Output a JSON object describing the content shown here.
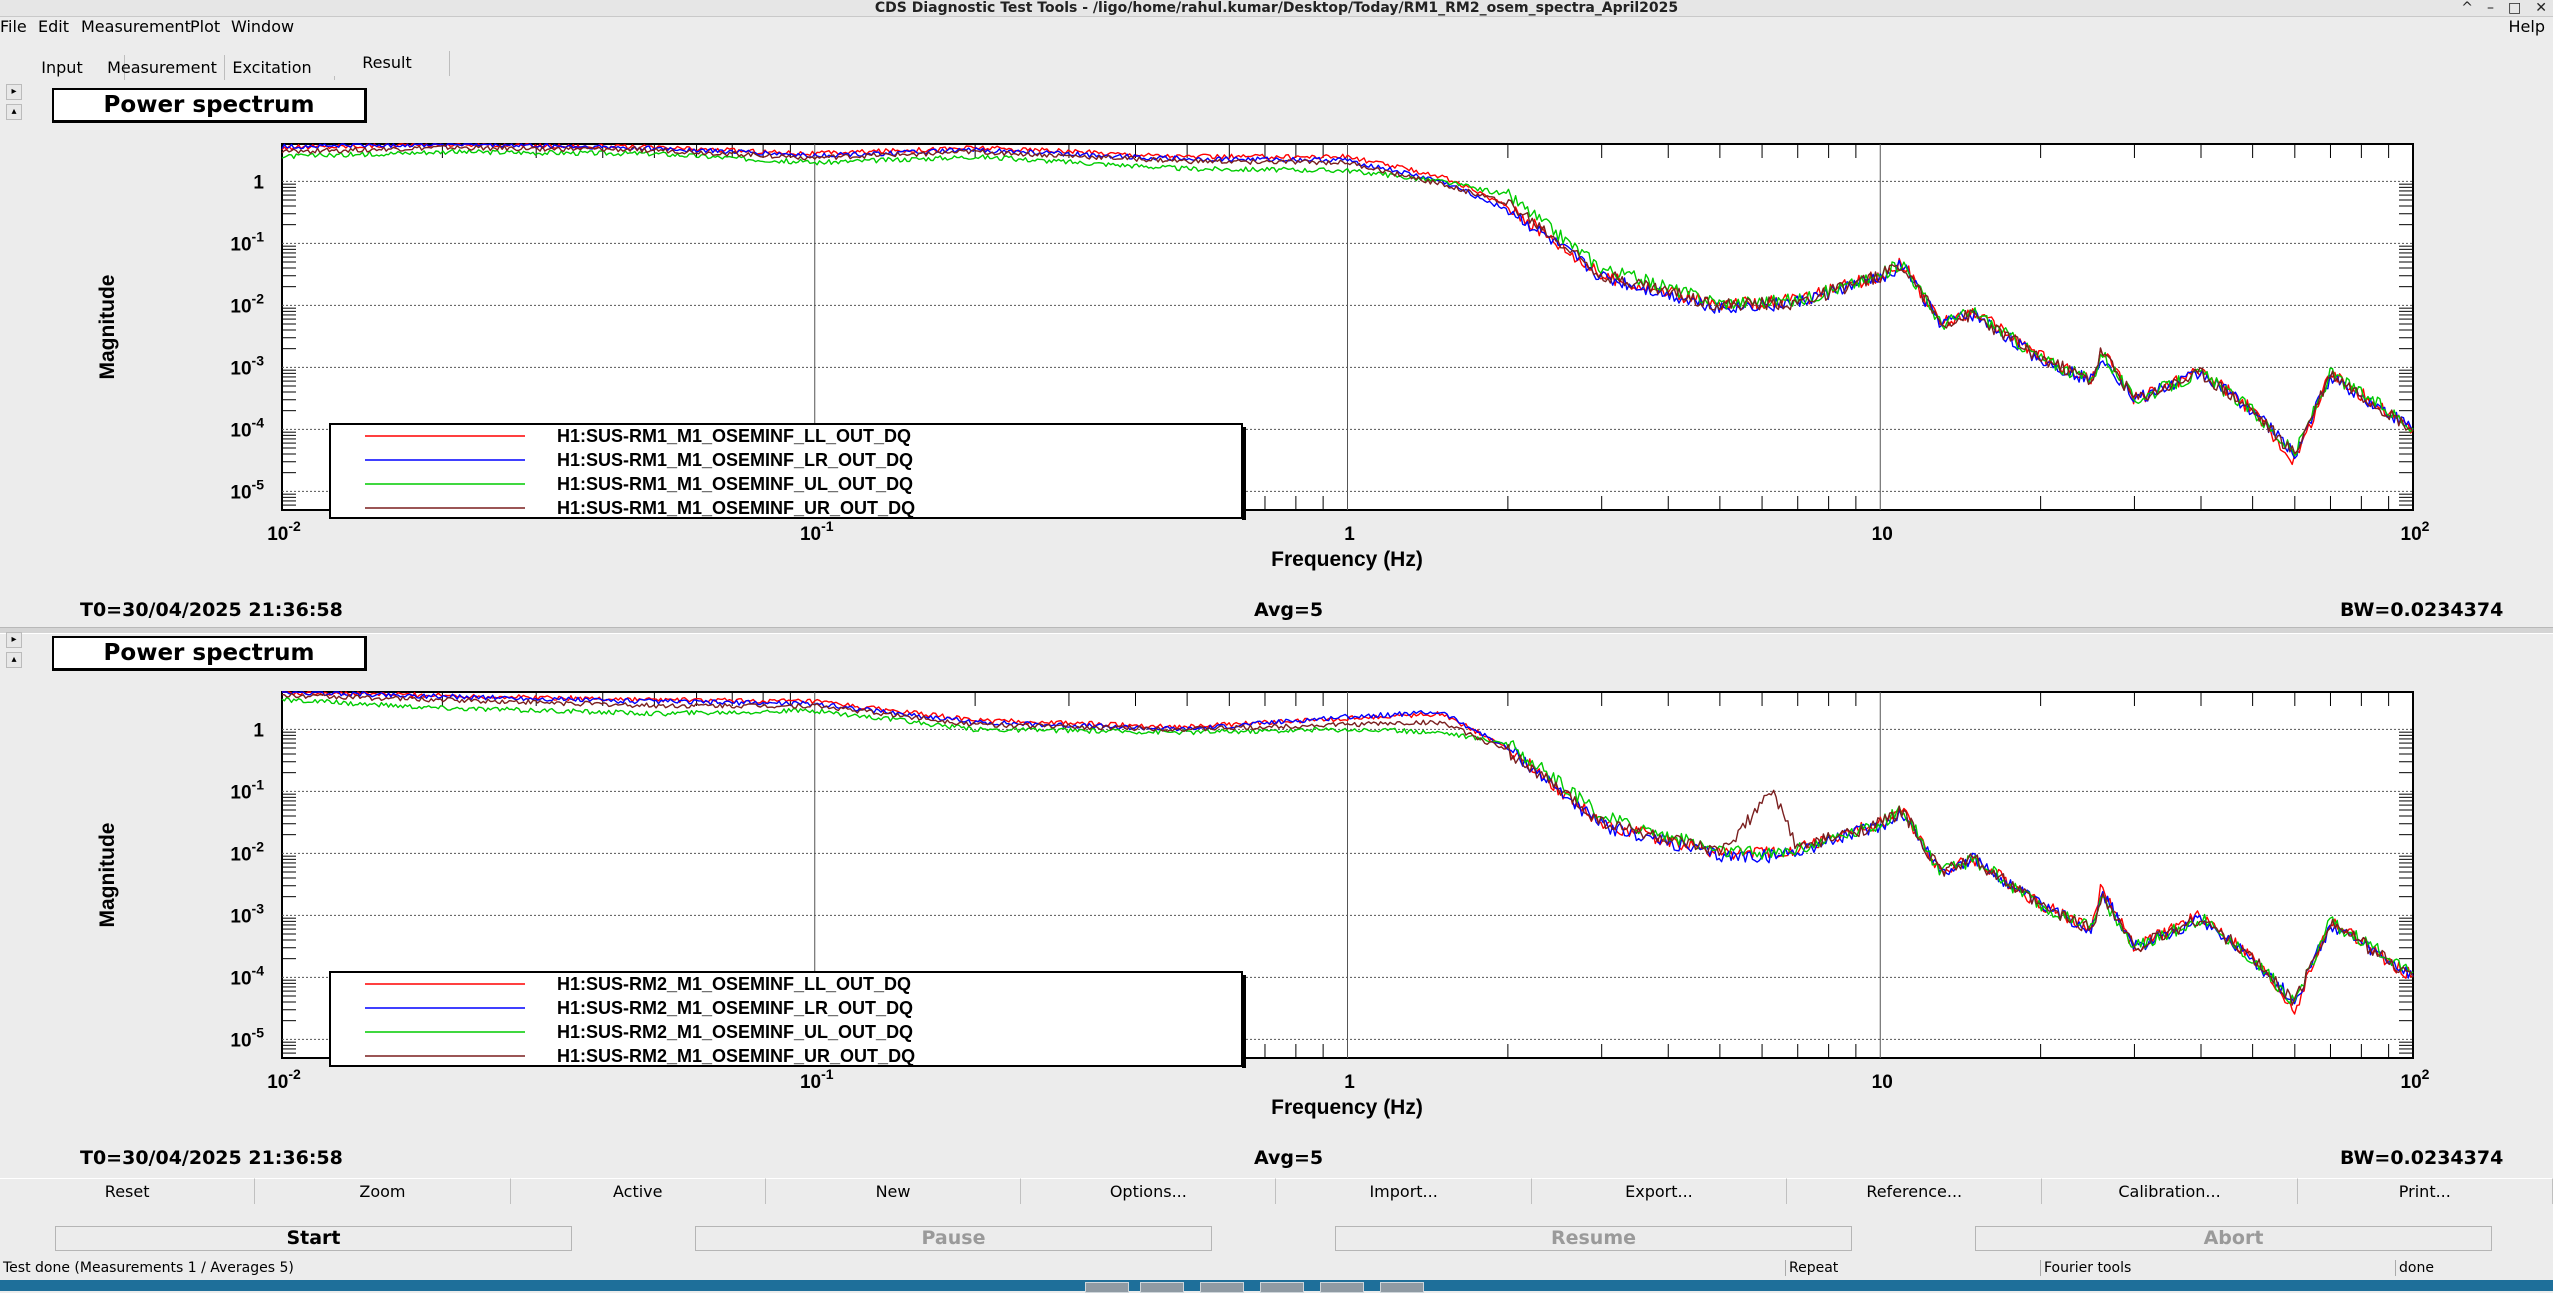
{
  "window": {
    "title": "CDS Diagnostic Test Tools - /ligo/home/rahul.kumar/Desktop/Today/RM1_RM2_osem_spectra_April2025",
    "controls": [
      "^",
      "–",
      "□",
      "✕"
    ]
  },
  "menu": {
    "items": [
      "File",
      "Edit",
      "Measurement",
      "Plot",
      "Window"
    ],
    "help": "Help"
  },
  "tabs": [
    {
      "label": "Input",
      "active": false
    },
    {
      "label": "Measurement",
      "active": false
    },
    {
      "label": "Excitation",
      "active": false
    },
    {
      "label": "Result",
      "active": true
    }
  ],
  "panels": [
    {
      "title": "Power spectrum",
      "ylabel": "Magnitude",
      "xlabel": "Frequency (Hz)",
      "t0": "T0=30/04/2025 21:36:58",
      "avg": "Avg=5",
      "bw": "BW=0.0234374",
      "legend": [
        {
          "name": "H1:SUS-RM1_M1_OSEMINF_LL_OUT_DQ",
          "color": "#ff0000"
        },
        {
          "name": "H1:SUS-RM1_M1_OSEMINF_LR_OUT_DQ",
          "color": "#0000ff"
        },
        {
          "name": "H1:SUS-RM1_M1_OSEMINF_UL_OUT_DQ",
          "color": "#00cc00"
        },
        {
          "name": "H1:SUS-RM1_M1_OSEMINF_UR_OUT_DQ",
          "color": "#7a1f1f"
        }
      ]
    },
    {
      "title": "Power spectrum",
      "ylabel": "Magnitude",
      "xlabel": "Frequency (Hz)",
      "t0": "T0=30/04/2025 21:36:58",
      "avg": "Avg=5",
      "bw": "BW=0.0234374",
      "legend": [
        {
          "name": "H1:SUS-RM2_M1_OSEMINF_LL_OUT_DQ",
          "color": "#ff0000"
        },
        {
          "name": "H1:SUS-RM2_M1_OSEMINF_LR_OUT_DQ",
          "color": "#0000ff"
        },
        {
          "name": "H1:SUS-RM2_M1_OSEMINF_UL_OUT_DQ",
          "color": "#00cc00"
        },
        {
          "name": "H1:SUS-RM2_M1_OSEMINF_UR_OUT_DQ",
          "color": "#7a1f1f"
        }
      ]
    }
  ],
  "chart_data": [
    {
      "type": "line",
      "title": "Power spectrum",
      "xlabel": "Frequency (Hz)",
      "ylabel": "Magnitude",
      "xscale": "log",
      "yscale": "log",
      "xlim": [
        0.01,
        100
      ],
      "ylim": [
        5e-06,
        4
      ],
      "x_ticks": [
        "10^-2",
        "10^-1",
        "1",
        "10",
        "10^2"
      ],
      "y_ticks": [
        "1",
        "10^-1",
        "10^-2",
        "10^-3",
        "10^-4",
        "10^-5"
      ],
      "grid": true,
      "legend_position": "bottom-left",
      "x": [
        0.01,
        0.02,
        0.05,
        0.1,
        0.2,
        0.5,
        1,
        1.5,
        2,
        3,
        5,
        7,
        10,
        11,
        13,
        15,
        20,
        25,
        26,
        30,
        40,
        50,
        60,
        70,
        100
      ],
      "series": [
        {
          "name": "H1:SUS-RM1_M1_OSEMINF_LL_OUT_DQ",
          "values": [
            3.5,
            4,
            3.5,
            2.8,
            3.5,
            2.5,
            2.5,
            1.2,
            0.4,
            0.03,
            0.01,
            0.012,
            0.03,
            0.05,
            0.005,
            0.008,
            0.0015,
            0.0006,
            0.002,
            0.0003,
            0.0009,
            0.0002,
            3e-05,
            0.0008,
            0.0001
          ]
        },
        {
          "name": "H1:SUS-RM1_M1_OSEMINF_LR_OUT_DQ",
          "values": [
            3.6,
            4,
            3.4,
            2.6,
            3.2,
            2.3,
            2.2,
            1.0,
            0.35,
            0.028,
            0.009,
            0.011,
            0.028,
            0.045,
            0.005,
            0.007,
            0.0013,
            0.0006,
            0.0016,
            0.0003,
            0.0008,
            0.0002,
            4e-05,
            0.0007,
            0.0001
          ]
        },
        {
          "name": "H1:SUS-RM1_M1_OSEMINF_UL_OUT_DQ",
          "values": [
            2.5,
            3,
            2.8,
            2.0,
            2.5,
            1.6,
            1.5,
            1.0,
            0.6,
            0.04,
            0.011,
            0.012,
            0.03,
            0.05,
            0.005,
            0.008,
            0.0014,
            0.0006,
            0.0018,
            0.0003,
            0.0008,
            0.0002,
            4e-05,
            0.0008,
            0.00011
          ]
        },
        {
          "name": "H1:SUS-RM1_M1_OSEMINF_UR_OUT_DQ",
          "values": [
            3.0,
            3.5,
            3.2,
            2.4,
            3.0,
            2.1,
            2.0,
            0.9,
            0.45,
            0.032,
            0.01,
            0.011,
            0.03,
            0.048,
            0.005,
            0.007,
            0.0014,
            0.0006,
            0.0019,
            0.0003,
            0.0008,
            0.0002,
            4e-05,
            0.0008,
            0.0001
          ]
        }
      ]
    },
    {
      "type": "line",
      "title": "Power spectrum",
      "xlabel": "Frequency (Hz)",
      "ylabel": "Magnitude",
      "xscale": "log",
      "yscale": "log",
      "xlim": [
        0.01,
        100
      ],
      "ylim": [
        5e-06,
        4
      ],
      "x_ticks": [
        "10^-2",
        "10^-1",
        "1",
        "10",
        "10^2"
      ],
      "y_ticks": [
        "1",
        "10^-1",
        "10^-2",
        "10^-3",
        "10^-4",
        "10^-5"
      ],
      "grid": true,
      "legend_position": "bottom-left",
      "x": [
        0.01,
        0.02,
        0.05,
        0.1,
        0.2,
        0.5,
        1,
        1.5,
        2,
        3,
        5,
        6.3,
        7,
        10,
        11,
        13,
        15,
        20,
        25,
        26,
        30,
        40,
        50,
        60,
        70,
        100
      ],
      "series": [
        {
          "name": "H1:SUS-RM2_M1_OSEMINF_LL_OUT_DQ",
          "values": [
            4,
            3.5,
            3.0,
            2.8,
            1.4,
            1.1,
            1.5,
            1.8,
            0.5,
            0.03,
            0.01,
            0.01,
            0.012,
            0.03,
            0.05,
            0.005,
            0.008,
            0.0015,
            0.0006,
            0.003,
            0.0003,
            0.001,
            0.0002,
            3e-05,
            0.0008,
            0.0001
          ]
        },
        {
          "name": "H1:SUS-RM2_M1_OSEMINF_LR_OUT_DQ",
          "values": [
            4,
            3.4,
            2.8,
            2.6,
            1.3,
            1.0,
            1.6,
            1.9,
            0.5,
            0.028,
            0.009,
            0.009,
            0.011,
            0.028,
            0.045,
            0.005,
            0.008,
            0.0014,
            0.0006,
            0.0025,
            0.0003,
            0.0009,
            0.0002,
            4e-05,
            0.0007,
            0.0001
          ]
        },
        {
          "name": "H1:SUS-RM2_M1_OSEMINF_UL_OUT_DQ",
          "values": [
            3,
            2.2,
            1.8,
            2.0,
            1.0,
            0.9,
            1.0,
            0.9,
            0.6,
            0.04,
            0.011,
            0.01,
            0.012,
            0.03,
            0.05,
            0.005,
            0.008,
            0.0014,
            0.0006,
            0.002,
            0.0003,
            0.0009,
            0.0002,
            4e-05,
            0.0008,
            0.00012
          ]
        },
        {
          "name": "H1:SUS-RM2_M1_OSEMINF_UR_OUT_DQ",
          "values": [
            3.5,
            3.0,
            2.4,
            2.4,
            1.2,
            1.0,
            1.2,
            1.3,
            0.45,
            0.032,
            0.01,
            0.1,
            0.012,
            0.03,
            0.048,
            0.005,
            0.008,
            0.0014,
            0.0006,
            0.0022,
            0.0003,
            0.0009,
            0.0002,
            4e-05,
            0.0008,
            0.0001
          ]
        }
      ]
    }
  ],
  "toolbar": [
    "Reset",
    "Zoom",
    "Active",
    "New",
    "Options...",
    "Import...",
    "Export...",
    "Reference...",
    "Calibration...",
    "Print..."
  ],
  "run_buttons": [
    {
      "label": "Start",
      "enabled": true
    },
    {
      "label": "Pause",
      "enabled": false
    },
    {
      "label": "Resume",
      "enabled": false
    },
    {
      "label": "Abort",
      "enabled": false
    }
  ],
  "status": {
    "message": "Test done (Measurements 1 / Averages 5)",
    "repeat": "Repeat",
    "tools": "Fourier tools",
    "state": "done"
  }
}
